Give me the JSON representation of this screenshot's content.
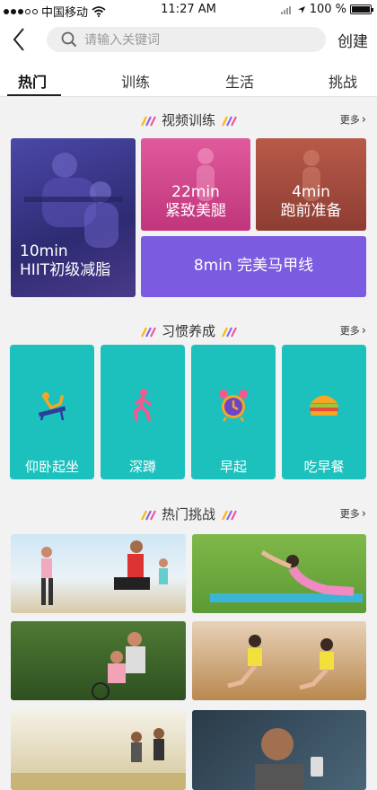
{
  "status_bar": {
    "carrier": "中国移动",
    "time": "11:27 AM",
    "battery": "100 %",
    "battery_level": 1.0
  },
  "nav": {
    "search_placeholder": "请输入关键词",
    "create_label": "创建"
  },
  "tabs": [
    {
      "label": "热门",
      "active": true
    },
    {
      "label": "训练",
      "active": false
    },
    {
      "label": "生活",
      "active": false
    },
    {
      "label": "挑战",
      "active": false
    }
  ],
  "sections": {
    "video": {
      "title": "视频训练",
      "more": "更多"
    },
    "habit": {
      "title": "习惯养成",
      "more": "更多"
    },
    "challenge": {
      "title": "热门挑战",
      "more": "更多"
    }
  },
  "video_tiles": [
    {
      "line1": "10min",
      "line2": "HIIT初级减脂",
      "color": "#3d3a8a"
    },
    {
      "line1": "22min",
      "line2": "紧致美腿",
      "color": "#d2458a"
    },
    {
      "line1": "4min",
      "line2": "跑前准备",
      "color": "#a84a3e"
    },
    {
      "line1": "8min  完美马甲线",
      "color": "#7b5ce0"
    }
  ],
  "habits": [
    {
      "label": "仰卧起坐",
      "icon": "situp-icon"
    },
    {
      "label": "深蹲",
      "icon": "squat-icon"
    },
    {
      "label": "早起",
      "icon": "alarm-clock-icon"
    },
    {
      "label": "吃早餐",
      "icon": "burger-icon"
    }
  ],
  "habit_color": "#1cc1bd"
}
